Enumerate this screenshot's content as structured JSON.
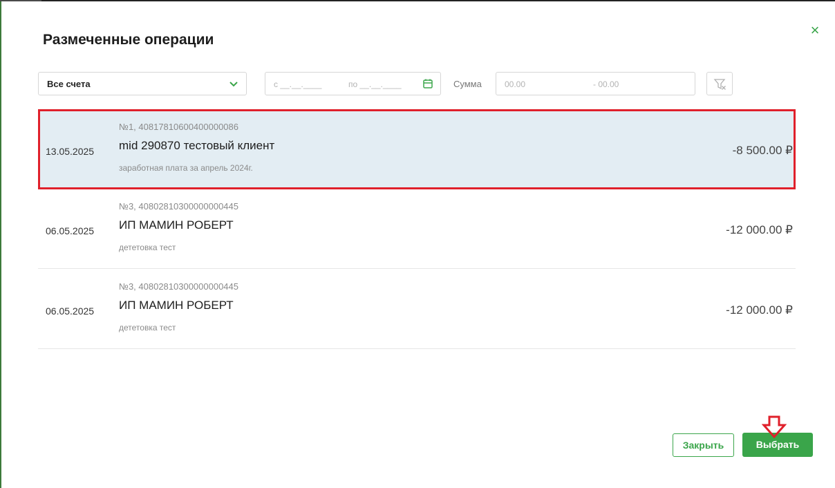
{
  "dialog": {
    "title": "Размеченные операции",
    "close_icon": "×"
  },
  "filters": {
    "account": "Все счета",
    "date_from": "с __.__.____",
    "date_to": "по __.__.____",
    "sum_label": "Сумма",
    "sum_min_placeholder": "00.00",
    "sum_max_placeholder": "- 00.00"
  },
  "operations": [
    {
      "date": "13.05.2025",
      "number": "№1, 40817810600400000086",
      "name": "mid 290870 тестовый клиент",
      "description": "заработная плата за апрель 2024г.",
      "amount": "-8 500.00 ₽",
      "selected": true
    },
    {
      "date": "06.05.2025",
      "number": "№3, 40802810300000000445",
      "name": "ИП МАМИН РОБЕРТ",
      "description": "дететовка тест",
      "amount": "-12 000.00 ₽",
      "selected": false
    },
    {
      "date": "06.05.2025",
      "number": "№3, 40802810300000000445",
      "name": "ИП МАМИН РОБЕРТ",
      "description": "дететовка тест",
      "amount": "-12 000.00 ₽",
      "selected": false
    }
  ],
  "footer": {
    "close_label": "Закрыть",
    "select_label": "Выбрать"
  },
  "colors": {
    "accent": "#3aa54a",
    "selected_bg": "#e3edf3",
    "highlight_border": "#e0202b"
  },
  "icons": {
    "dropdown": "chevron-down-icon",
    "calendar": "calendar-icon",
    "clear_filter": "filter-clear-icon",
    "close": "close-icon",
    "annotation": "arrow-down-annotation-icon"
  }
}
